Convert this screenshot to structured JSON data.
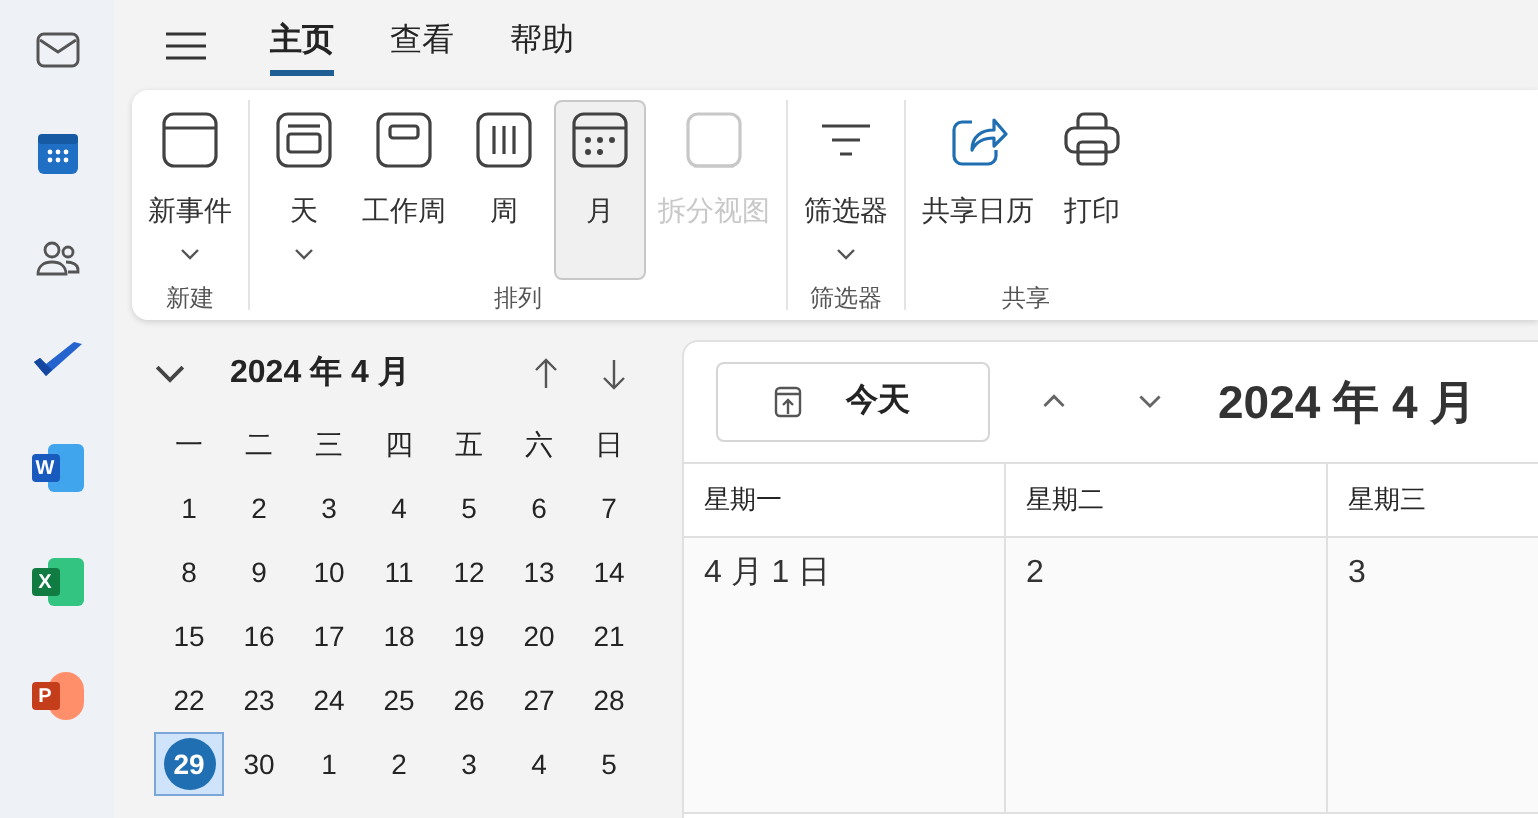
{
  "rail": [
    {
      "kind": "mail"
    },
    {
      "kind": "calendar"
    },
    {
      "kind": "people"
    },
    {
      "kind": "todo"
    },
    {
      "kind": "word",
      "letter": "W"
    },
    {
      "kind": "excel",
      "letter": "X"
    },
    {
      "kind": "powerpoint",
      "letter": "P"
    }
  ],
  "tabs": [
    {
      "label": "主页",
      "selected": true
    },
    {
      "label": "查看",
      "selected": false
    },
    {
      "label": "帮助",
      "selected": false
    }
  ],
  "ribbon": {
    "groups": [
      {
        "label": "新建",
        "buttons": [
          {
            "label": "新事件",
            "kind": "new-event",
            "dropdown": true,
            "selected": false,
            "disabled": false
          }
        ]
      },
      {
        "label": "排列",
        "buttons": [
          {
            "label": "天",
            "kind": "day",
            "dropdown": true,
            "selected": false,
            "disabled": false
          },
          {
            "label": "工作周",
            "kind": "work-week",
            "dropdown": false,
            "selected": false,
            "disabled": false
          },
          {
            "label": "周",
            "kind": "week",
            "dropdown": false,
            "selected": false,
            "disabled": false
          },
          {
            "label": "月",
            "kind": "month",
            "dropdown": false,
            "selected": true,
            "disabled": false
          },
          {
            "label": "拆分视图",
            "kind": "split",
            "dropdown": false,
            "selected": false,
            "disabled": true
          }
        ]
      },
      {
        "label": "筛选器",
        "buttons": [
          {
            "label": "筛选器",
            "kind": "filter",
            "dropdown": true,
            "selected": false,
            "disabled": false
          }
        ]
      },
      {
        "label": "共享",
        "buttons": [
          {
            "label": "共享日历",
            "kind": "share",
            "dropdown": false,
            "selected": false,
            "disabled": false
          },
          {
            "label": "打印",
            "kind": "print",
            "dropdown": false,
            "selected": false,
            "disabled": false
          }
        ]
      }
    ]
  },
  "mini_calendar": {
    "title": "2024 年 4 月",
    "weekdays": [
      "一",
      "二",
      "三",
      "四",
      "五",
      "六",
      "日"
    ],
    "weeks": [
      [
        {
          "label": "1",
          "selected": false
        },
        {
          "label": "2",
          "selected": false
        },
        {
          "label": "3",
          "selected": false
        },
        {
          "label": "4",
          "selected": false
        },
        {
          "label": "5",
          "selected": false
        },
        {
          "label": "6",
          "selected": false
        },
        {
          "label": "7",
          "selected": false
        }
      ],
      [
        {
          "label": "8",
          "selected": false
        },
        {
          "label": "9",
          "selected": false
        },
        {
          "label": "10",
          "selected": false
        },
        {
          "label": "11",
          "selected": false
        },
        {
          "label": "12",
          "selected": false
        },
        {
          "label": "13",
          "selected": false
        },
        {
          "label": "14",
          "selected": false
        }
      ],
      [
        {
          "label": "15",
          "selected": false
        },
        {
          "label": "16",
          "selected": false
        },
        {
          "label": "17",
          "selected": false
        },
        {
          "label": "18",
          "selected": false
        },
        {
          "label": "19",
          "selected": false
        },
        {
          "label": "20",
          "selected": false
        },
        {
          "label": "21",
          "selected": false
        }
      ],
      [
        {
          "label": "22",
          "selected": false
        },
        {
          "label": "23",
          "selected": false
        },
        {
          "label": "24",
          "selected": false
        },
        {
          "label": "25",
          "selected": false
        },
        {
          "label": "26",
          "selected": false
        },
        {
          "label": "27",
          "selected": false
        },
        {
          "label": "28",
          "selected": false
        }
      ],
      [
        {
          "label": "29",
          "selected": true
        },
        {
          "label": "30",
          "selected": false
        },
        {
          "label": "1",
          "selected": false
        },
        {
          "label": "2",
          "selected": false
        },
        {
          "label": "3",
          "selected": false
        },
        {
          "label": "4",
          "selected": false
        },
        {
          "label": "5",
          "selected": false
        }
      ]
    ]
  },
  "month_view": {
    "today_button": "今天",
    "title": "2024 年 4 月",
    "columns": [
      "星期一",
      "星期二",
      "星期三"
    ],
    "cells": [
      "4 月 1 日",
      "2",
      "3"
    ]
  }
}
